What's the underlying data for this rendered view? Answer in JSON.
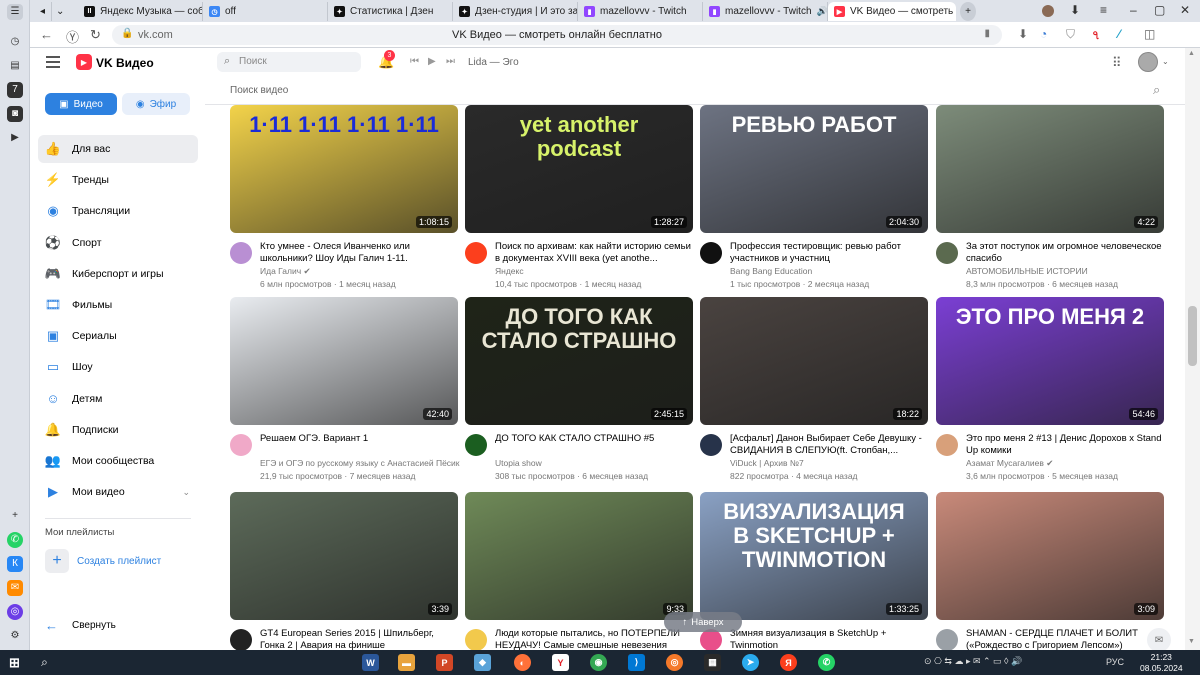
{
  "browser": {
    "tabs": [
      {
        "title": "Яндекс Музыка — собир",
        "fav": "II",
        "color": "#111111"
      },
      {
        "title": "off",
        "fav": "◷",
        "color": "#3b87f5"
      },
      {
        "title": "Статистика | Дзен",
        "fav": "✦",
        "color": "#111111"
      },
      {
        "title": "Дзен-студия | И это заме",
        "fav": "✦",
        "color": "#111111"
      },
      {
        "title": "mazellovvv - Twitch",
        "fav": "▮",
        "color": "#9146ff"
      },
      {
        "title": "mazellovvv - Twitch",
        "fav": "▮",
        "color": "#9146ff"
      },
      {
        "title": "VK Видео — смотреть о",
        "fav": "▶",
        "color": "#ff3347"
      }
    ],
    "url": "vk.com",
    "page_title": "VK Видео — смотреть онлайн бесплатно"
  },
  "header": {
    "brand": "VK Видео",
    "search_placeholder": "Поиск",
    "notifications_count": "3",
    "track": "Lida — Эго"
  },
  "sidebar": {
    "video_btn": "Видео",
    "efir_btn": "Эфир",
    "items": [
      {
        "label": "Для вас",
        "icon": "thumb-up-icon",
        "glyph": "👍"
      },
      {
        "label": "Тренды",
        "icon": "flame-icon",
        "glyph": "⚡"
      },
      {
        "label": "Трансляции",
        "icon": "broadcast-icon",
        "glyph": "◉"
      },
      {
        "label": "Спорт",
        "icon": "ball-icon",
        "glyph": "⚽"
      },
      {
        "label": "Киберспорт и игры",
        "icon": "gamepad-icon",
        "glyph": "🎮"
      },
      {
        "label": "Фильмы",
        "icon": "film-icon",
        "glyph": "🎞"
      },
      {
        "label": "Сериалы",
        "icon": "series-icon",
        "glyph": "▣"
      },
      {
        "label": "Шоу",
        "icon": "tv-icon",
        "glyph": "▭"
      },
      {
        "label": "Детям",
        "icon": "kids-icon",
        "glyph": "☺"
      },
      {
        "label": "Подписки",
        "icon": "bell-icon",
        "glyph": "🔔"
      },
      {
        "label": "Мои сообщества",
        "icon": "community-icon",
        "glyph": "👥"
      },
      {
        "label": "Мои видео",
        "icon": "my-video-icon",
        "glyph": "▶"
      }
    ],
    "playlists_label": "Мои плейлисты",
    "create_playlist": "Создать плейлист",
    "collapse": "Свернуть"
  },
  "main": {
    "search_placeholder": "Поиск видео",
    "scroll_top": "Наверх",
    "videos": [
      {
        "title": "Кто умнее - Олеся Иванченко или школьники? Шоу Иды Галич 1-11.",
        "channel": "Ида Галич ✔",
        "meta": "6 млн просмотров · 1 месяц назад",
        "duration": "1:08:15",
        "thumb_text": "1·11  1·11  1·11  1·11",
        "bg": "#f3d34a",
        "fg": "#1a2bd8",
        "avatar": "#b98fd3"
      },
      {
        "title": "Поиск по архивам: как найти историю семьи в документах XVIII века (yet anothe...",
        "channel": "Яндекс",
        "meta": "10,4 тыс просмотров · 1 месяц назад",
        "duration": "1:28:27",
        "thumb_text": "yet another podcast",
        "bg": "#2a2a2a",
        "fg": "#d7f26a",
        "avatar": "#fc3f1d"
      },
      {
        "title": "Профессия тестировщик: ревью работ участников и участниц",
        "channel": "Bang Bang Education",
        "meta": "1 тыс просмотров · 2 месяца назад",
        "duration": "2:04:30",
        "thumb_text": "РЕВЬЮ РАБОТ",
        "bg": "#6d7382",
        "fg": "#ffffff",
        "avatar": "#111111"
      },
      {
        "title": "За этот поступок им огромное человеческое спасибо",
        "channel": "АВТОМОБИЛЬНЫЕ ИСТОРИИ",
        "meta": "8,3 млн просмотров · 6 месяцев назад",
        "duration": "4:22",
        "thumb_text": "",
        "bg": "#7d8c7a",
        "fg": "#ffffff",
        "avatar": "#5b6a4f"
      },
      {
        "title": "Решаем ОГЭ. Вариант 1",
        "channel": "ЕГЭ и ОГЭ по русскому языку с Анастасией Пёсик",
        "meta": "21,9 тыс просмотров · 7 месяцев назад",
        "duration": "42:40",
        "thumb_text": "",
        "bg": "#e9ecf0",
        "fg": "#333333",
        "avatar": "#f0a9c8"
      },
      {
        "title": "ДО ТОГО КАК СТАЛО СТРАШНО #5",
        "channel": "Utopia show",
        "meta": "308 тыс просмотров · 6 месяцев назад",
        "duration": "2:45:15",
        "thumb_text": "ДО ТОГО КАК СТАЛО СТРАШНО",
        "bg": "#1f2418",
        "fg": "#e9e6d4",
        "avatar": "#1b5e20"
      },
      {
        "title": "[Асфальт] Данон Выбирает Себе Девушку - СВИДАНИЯ В СЛЕПУЮ(ft. Стопбан,...",
        "channel": "ViDuck | Архив №7",
        "meta": "822 просмотра · 4 месяца назад",
        "duration": "18:22",
        "thumb_text": "",
        "bg": "#4a4340",
        "fg": "#ffffff",
        "avatar": "#27334a"
      },
      {
        "title": "Это про меня 2 #13 | Денис Дорохов х Stand Up комики",
        "channel": "Азамат Мусагалиев ✔",
        "meta": "3,6 млн просмотров · 5 месяцев назад",
        "duration": "54:46",
        "thumb_text": "ЭТО ПРО МЕНЯ 2",
        "bg": "#7b3fd4",
        "fg": "#ffffff",
        "avatar": "#d8a07a"
      },
      {
        "title": "GT4 European Series 2015 | Шпильберг, Гонка 2 | Авария на финише",
        "channel": "",
        "meta": "",
        "duration": "3:39",
        "thumb_text": "",
        "bg": "#5d6b5a",
        "fg": "#ffffff",
        "avatar": "#222222"
      },
      {
        "title": "Люди которые пытались, но ПОТЕРПЕЛИ НЕУДАЧУ! Самые смешные невезения",
        "channel": "",
        "meta": "",
        "duration": "9:33",
        "thumb_text": "",
        "bg": "#6f8a58",
        "fg": "#ffffff",
        "avatar": "#f2c94c"
      },
      {
        "title": "Зимняя визуализация в SketchUp + Twinmotion",
        "channel": "",
        "meta": "",
        "duration": "1:33:25",
        "thumb_text": "ВИЗУАЛИЗАЦИЯ В SKETCHUP + TWINMOTION",
        "bg": "#8aa1c4",
        "fg": "#ffffff",
        "avatar": "#e94f8a"
      },
      {
        "title": "SHAMAN - СЕРДЦЕ ПЛАЧЕТ И БОЛИТ («Рождество с Григорием Лепсом»)",
        "channel": "",
        "meta": "",
        "duration": "3:09",
        "thumb_text": "",
        "bg": "#c98a7a",
        "fg": "#ffffff",
        "avatar": "#9aa0a6"
      }
    ]
  },
  "taskbar": {
    "lang": "РУС",
    "time": "21:23",
    "date": "08.05.2024"
  }
}
